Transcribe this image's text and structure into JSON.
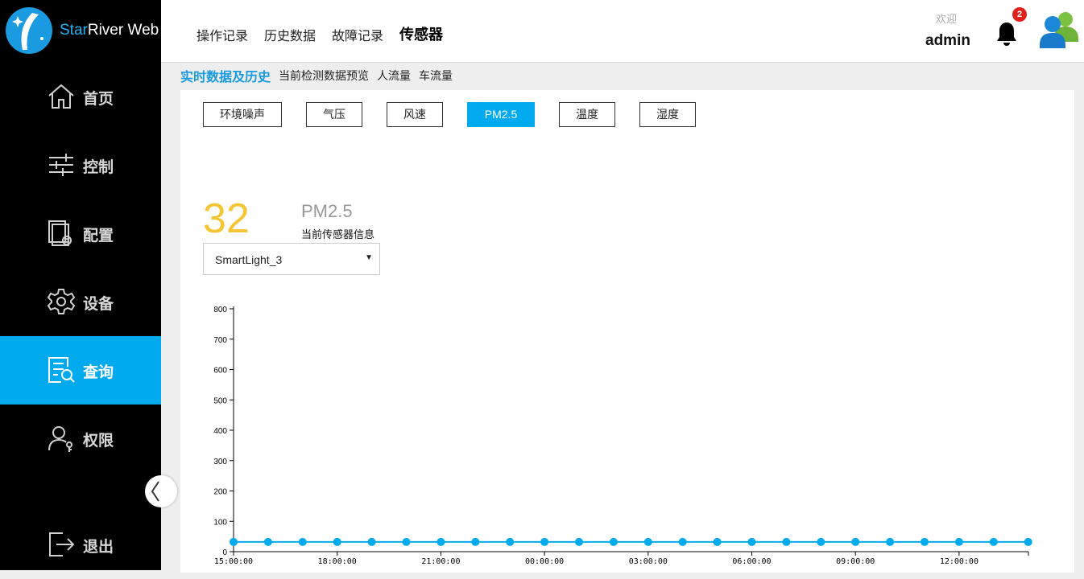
{
  "app": {
    "title_part1": "Star",
    "title_part2": "River Web"
  },
  "sidebar": {
    "items": [
      {
        "label": "首页",
        "icon": "home-icon"
      },
      {
        "label": "控制",
        "icon": "sliders-icon"
      },
      {
        "label": "配置",
        "icon": "config-icon"
      },
      {
        "label": "设备",
        "icon": "gear-icon"
      },
      {
        "label": "查询",
        "icon": "search-doc-icon",
        "active": true
      },
      {
        "label": "权限",
        "icon": "user-key-icon"
      }
    ],
    "logout_label": "退出"
  },
  "header": {
    "nav": [
      "操作记录",
      "历史数据",
      "故障记录",
      "传感器"
    ],
    "active_nav": "传感器",
    "welcome": "欢迎",
    "username": "admin",
    "notification_count": "2"
  },
  "subnav": {
    "items": [
      "实时数据及历史",
      "当前检测数据预览",
      "人流量",
      "车流量"
    ],
    "active": "实时数据及历史"
  },
  "sensor_tabs": [
    "环境噪声",
    "气压",
    "风速",
    "PM2.5",
    "温度",
    "湿度"
  ],
  "active_tab": "PM2.5",
  "current": {
    "value": "32",
    "name": "PM2.5",
    "subtitle": "当前传感器信息",
    "device": "SmartLight_3"
  },
  "colors": {
    "accent": "#00aaee",
    "value": "#f5c535",
    "line": "#00aaee",
    "badge": "#e0201a"
  },
  "chart_data": {
    "type": "line",
    "ylim": [
      0,
      800
    ],
    "yticks": [
      0,
      100,
      200,
      300,
      400,
      500,
      600,
      700,
      800
    ],
    "xtick_labels": [
      "15:00:00",
      "18:00:00",
      "21:00:00",
      "00:00:00",
      "03:00:00",
      "06:00:00",
      "09:00:00",
      "12:00:00"
    ],
    "x": [
      "15:00",
      "16:00",
      "17:00",
      "18:00",
      "19:00",
      "20:00",
      "21:00",
      "22:00",
      "23:00",
      "00:00",
      "01:00",
      "02:00",
      "03:00",
      "04:00",
      "05:00",
      "06:00",
      "07:00",
      "08:00",
      "09:00",
      "10:00",
      "11:00",
      "12:00",
      "13:00",
      "14:00"
    ],
    "series": [
      {
        "values": [
          32,
          32,
          32,
          32,
          32,
          32,
          32,
          32,
          32,
          32,
          32,
          32,
          32,
          32,
          32,
          32,
          32,
          32,
          32,
          32,
          32,
          32,
          32,
          32
        ]
      }
    ]
  }
}
